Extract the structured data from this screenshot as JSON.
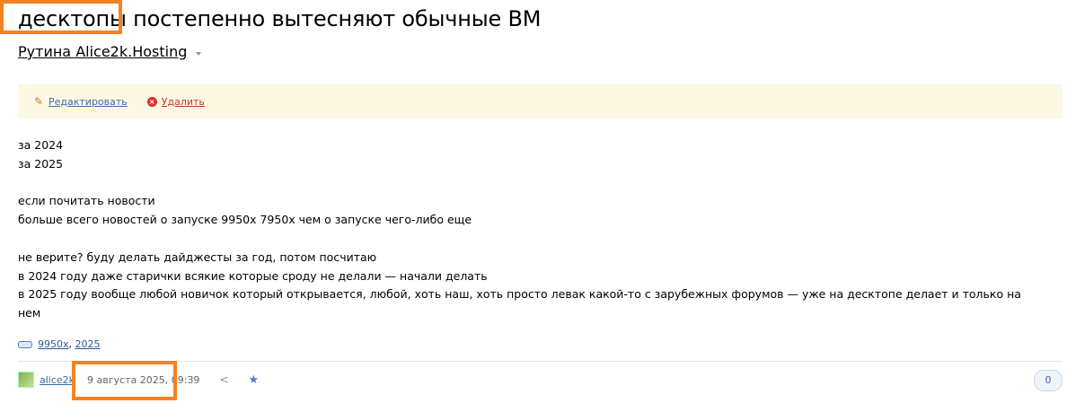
{
  "post": {
    "title": "десктопы постепенно вытесняют обычные ВМ",
    "blog_name": "Рутина Alice2k.Hosting"
  },
  "actions": {
    "edit_label": "Редактировать",
    "delete_label": "Удалить"
  },
  "content": {
    "lines": [
      "за 2024",
      "за 2025",
      "",
      "если почитать новости",
      "больше всего новостей о запуске 9950x 7950x чем о запуске чего-либо еще",
      "",
      "не верите? буду делать дайджесты за год, потом посчитаю",
      "в 2024 году даже старички всякие которые сроду не делали — начали делать",
      "в 2025 году вообще любой новичок который открывается, любой, хоть наш, хоть просто левак какой-то с зарубежных форумов — уже на десктопе делает и только на",
      "нем"
    ]
  },
  "tags": {
    "items": [
      "9950x",
      "2025"
    ],
    "separator": ", "
  },
  "footer": {
    "author": "alice2k",
    "datetime": "9 августа 2025, 09:39",
    "vote_count": "0"
  },
  "icons": {
    "edit": "pencil-icon",
    "delete": "x-circle-icon",
    "tags": "tag-icon",
    "share": "share-icon",
    "favorite": "star-icon",
    "caret": "chevron-down-icon"
  },
  "colors": {
    "highlight": "#f58222",
    "action_bar_bg": "#fcf8e3",
    "link": "#3b6ea6",
    "delete": "#c0392b"
  }
}
